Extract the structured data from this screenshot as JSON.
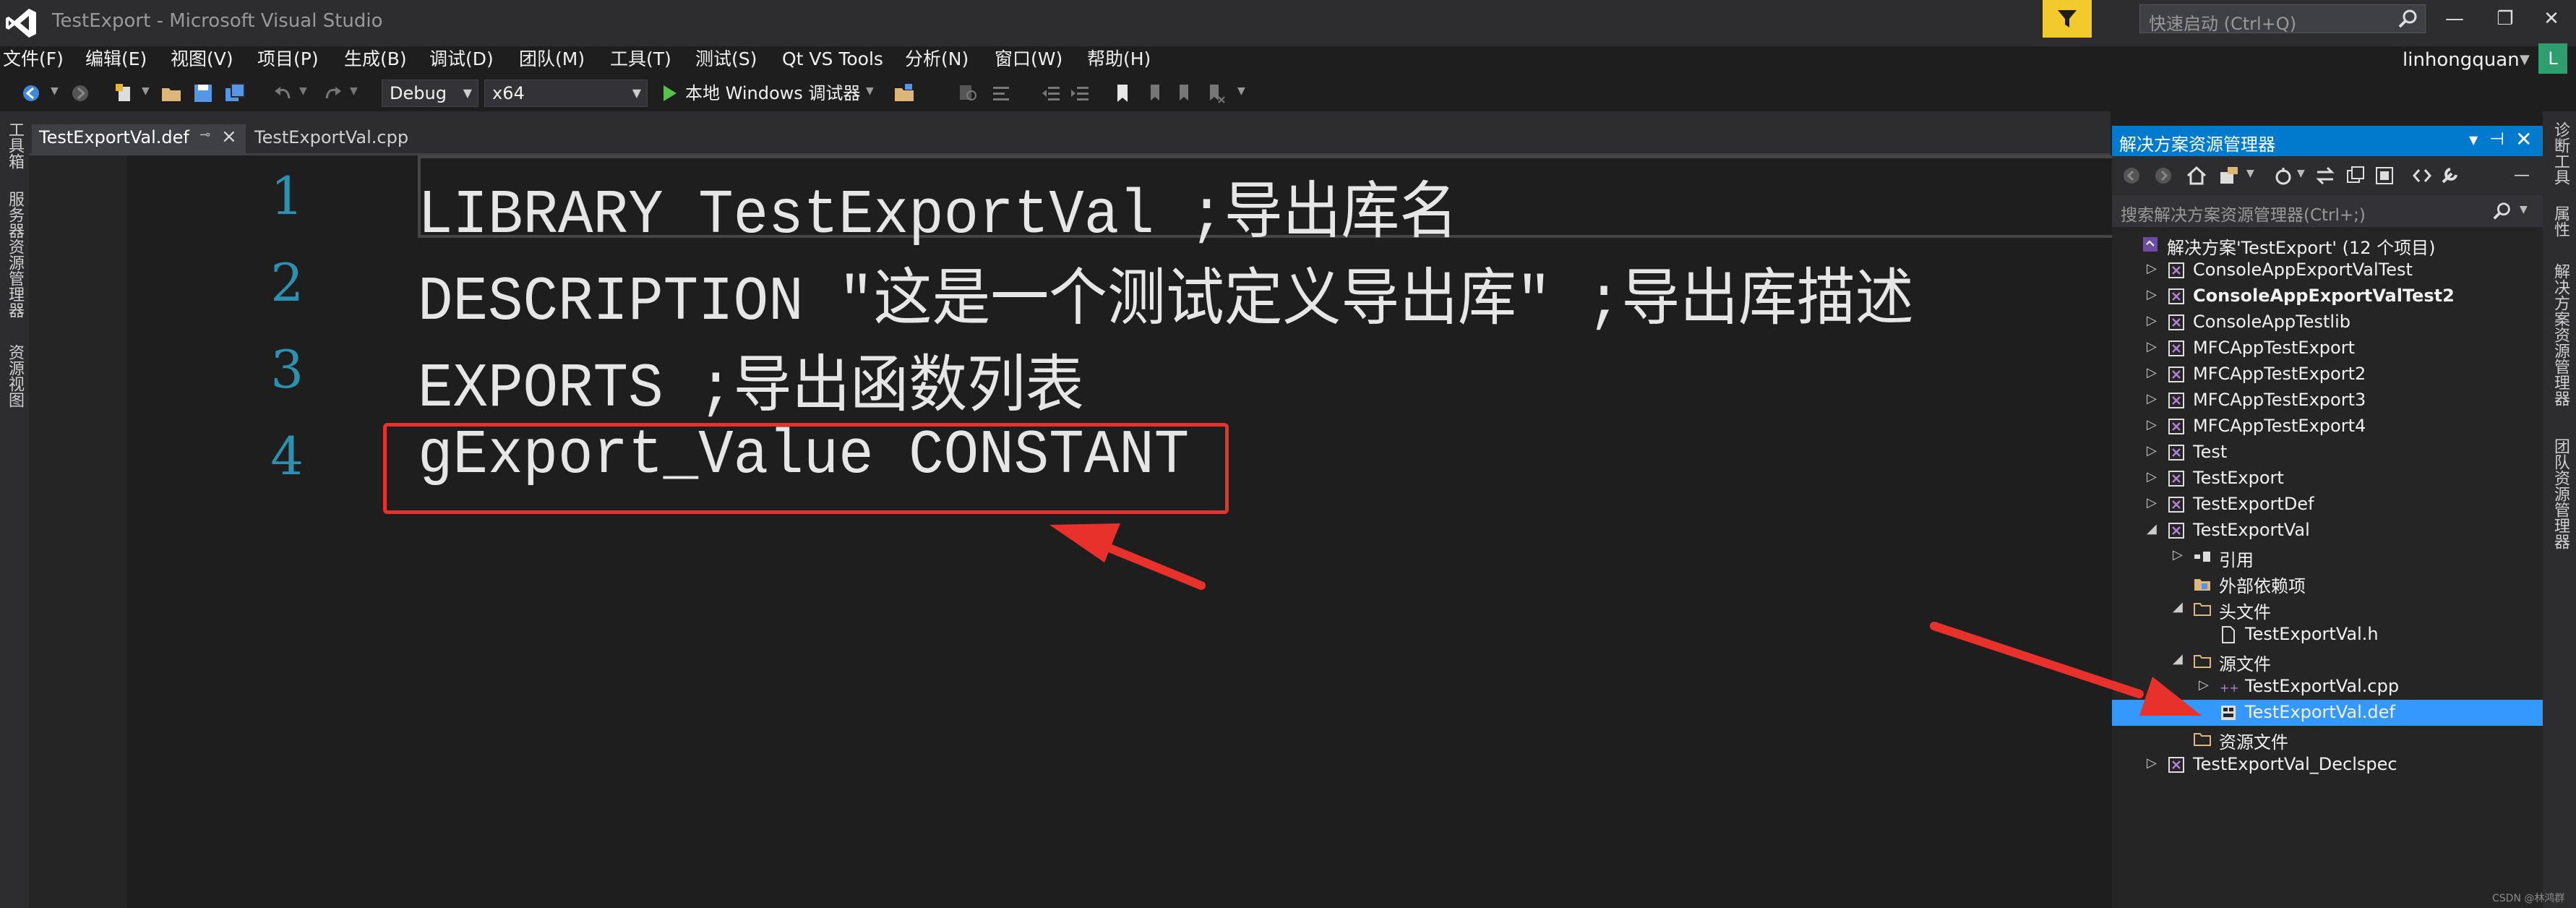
{
  "window": {
    "title": "TestExport - Microsoft Visual Studio",
    "quick_launch_placeholder": "快速启动 (Ctrl+Q)",
    "user": "linhongquan",
    "user_initial": "L"
  },
  "menu": [
    "文件(F)",
    "编辑(E)",
    "视图(V)",
    "项目(P)",
    "生成(B)",
    "调试(D)",
    "团队(M)",
    "工具(T)",
    "测试(S)",
    "Qt VS Tools",
    "分析(N)",
    "窗口(W)",
    "帮助(H)"
  ],
  "toolbar": {
    "configuration": "Debug",
    "platform": "x64",
    "run_label": "本地 Windows 调试器"
  },
  "left_panels": [
    "工具箱",
    "服务器资源管理器",
    "资源视图"
  ],
  "right_panels": [
    "诊断工具",
    "属性",
    "解决方案资源管理器",
    "团队资源管理器"
  ],
  "tabs": [
    {
      "label": "TestExportVal.def",
      "active": true
    },
    {
      "label": "TestExportVal.cpp",
      "active": false
    }
  ],
  "editor": {
    "lines": [
      {
        "number": "1",
        "text": "LIBRARY TestExportVal ;导出库名"
      },
      {
        "number": "2",
        "text": "DESCRIPTION ″这是一个测试定义导出库″ ;导出库描述"
      },
      {
        "number": "3",
        "text": "EXPORTS ;导出函数列表"
      },
      {
        "number": "4",
        "text": "gExport_Value CONSTANT"
      }
    ]
  },
  "solution_explorer": {
    "title": "解决方案资源管理器",
    "search_placeholder": "搜索解决方案资源管理器(Ctrl+;)",
    "items": [
      {
        "label": "解决方案'TestExport' (12 个项目)",
        "icon": "solution-icon",
        "expander": "none"
      },
      {
        "label": "ConsoleAppExportValTest",
        "icon": "project-icon",
        "expander": "collapsed"
      },
      {
        "label": "ConsoleAppExportValTest2",
        "icon": "project-icon",
        "expander": "collapsed",
        "bold": true
      },
      {
        "label": "ConsoleAppTestlib",
        "icon": "project-icon",
        "expander": "collapsed"
      },
      {
        "label": "MFCAppTestExport",
        "icon": "project-icon",
        "expander": "collapsed"
      },
      {
        "label": "MFCAppTestExport2",
        "icon": "project-icon",
        "expander": "collapsed"
      },
      {
        "label": "MFCAppTestExport3",
        "icon": "project-icon",
        "expander": "collapsed"
      },
      {
        "label": "MFCAppTestExport4",
        "icon": "project-icon",
        "expander": "collapsed"
      },
      {
        "label": "Test",
        "icon": "project-icon",
        "expander": "collapsed"
      },
      {
        "label": "TestExport",
        "icon": "project-icon",
        "expander": "collapsed"
      },
      {
        "label": "TestExportDef",
        "icon": "project-icon",
        "expander": "collapsed"
      },
      {
        "label": "TestExportVal",
        "icon": "project-icon",
        "expander": "expanded"
      },
      {
        "label": "引用",
        "icon": "references-icon",
        "expander": "collapsed"
      },
      {
        "label": "外部依赖项",
        "icon": "external-deps-icon",
        "expander": "none"
      },
      {
        "label": "头文件",
        "icon": "folder-icon",
        "expander": "expanded"
      },
      {
        "label": "TestExportVal.h",
        "icon": "header-file-icon",
        "expander": "none"
      },
      {
        "label": "源文件",
        "icon": "folder-icon",
        "expander": "expanded"
      },
      {
        "label": "TestExportVal.cpp",
        "icon": "cpp-file-icon",
        "expander": "collapsed"
      },
      {
        "label": "TestExportVal.def",
        "icon": "def-file-icon",
        "expander": "none",
        "selected": true
      },
      {
        "label": "资源文件",
        "icon": "folder-icon",
        "expander": "none"
      },
      {
        "label": "TestExportVal_Declspec",
        "icon": "project-icon",
        "expander": "collapsed"
      }
    ]
  },
  "watermark": "CSDN @林鸿群",
  "colors": {
    "accent": "#007acc",
    "selection": "#3399ff",
    "line_number": "#2b91af",
    "annotation": "#e8312a"
  }
}
